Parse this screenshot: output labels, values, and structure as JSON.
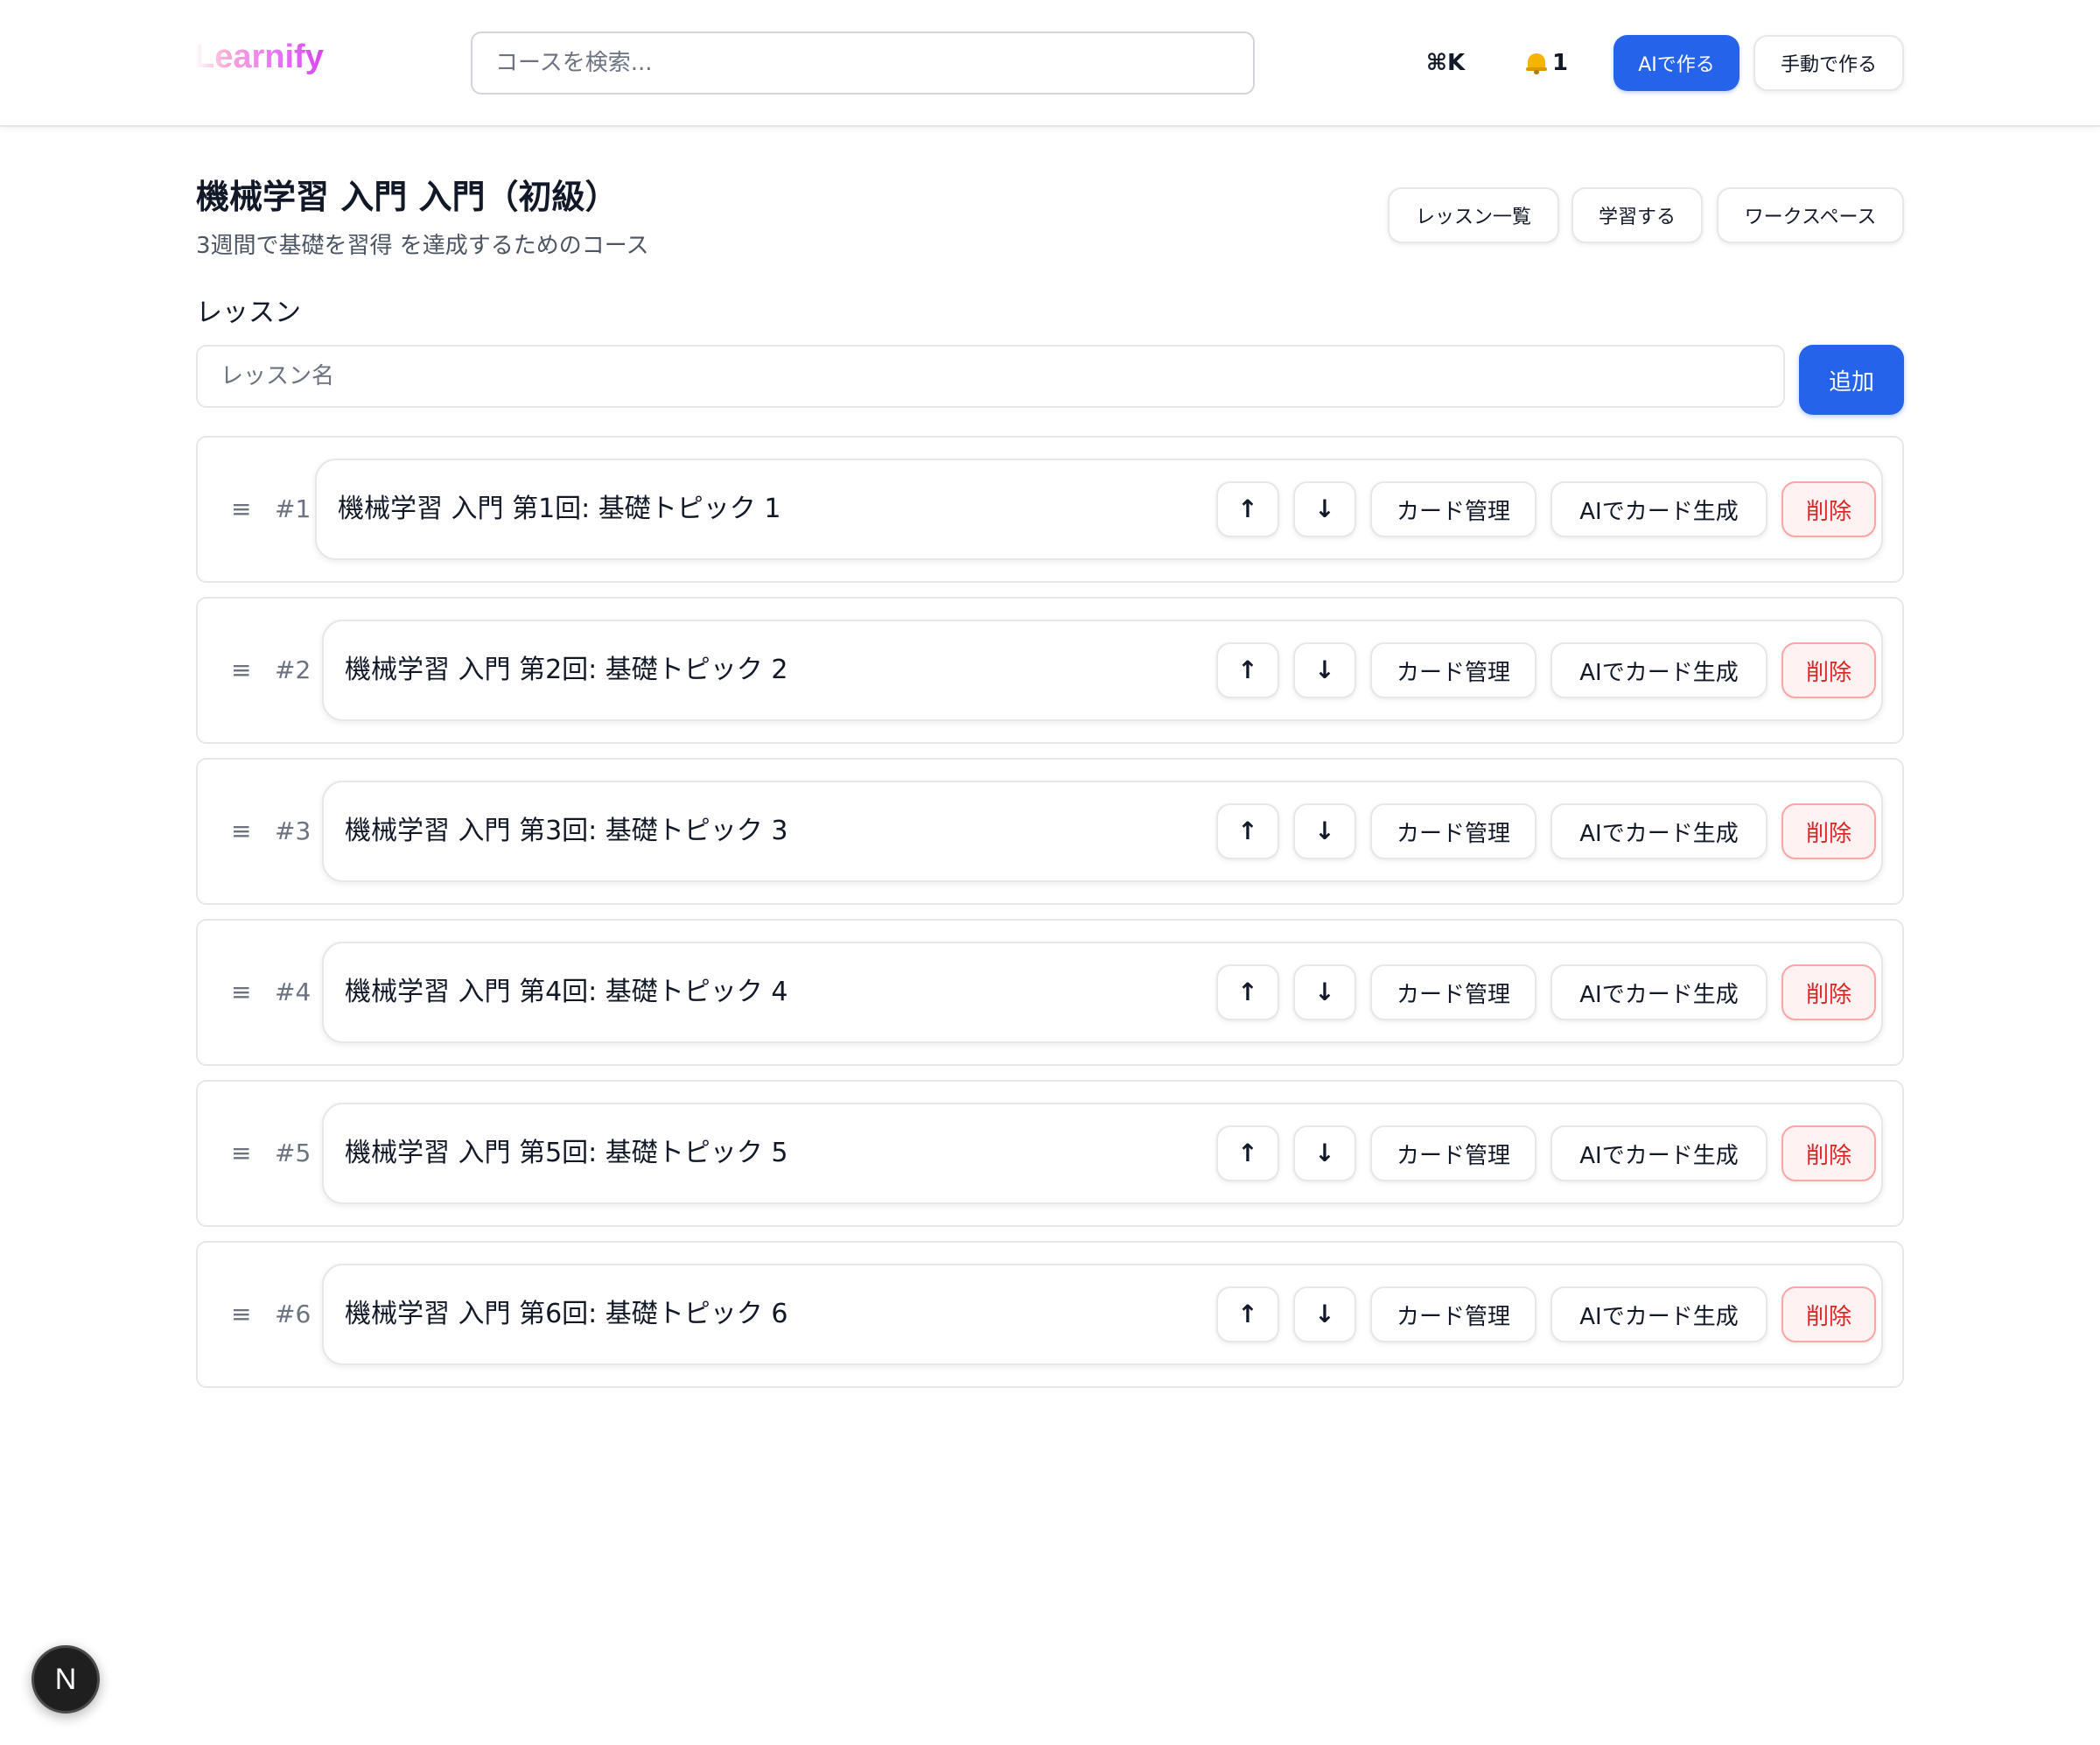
{
  "header": {
    "logo": "Learnify",
    "search_placeholder": "コースを検索...",
    "shortcut": "⌘K",
    "notification_count": "1",
    "ai_create_label": "AIで作る",
    "manual_create_label": "手動で作る"
  },
  "course": {
    "title": "機械学習 入門 入門（初級）",
    "subtitle": "3週間で基礎を習得 を達成するためのコース",
    "nav": {
      "lessons_label": "レッスン一覧",
      "study_label": "学習する",
      "workspace_label": "ワークスペース"
    }
  },
  "lessons_section": {
    "label": "レッスン",
    "input_placeholder": "レッスン名",
    "add_label": "追加"
  },
  "lesson_actions": {
    "up": "↑",
    "down": "↓",
    "cards": "カード管理",
    "ai_cards": "AIでカード生成",
    "delete": "削除"
  },
  "lessons": [
    {
      "num": "#1",
      "title": "機械学習 入門 第1回: 基礎トピック 1"
    },
    {
      "num": "#2",
      "title": "機械学習 入門 第2回: 基礎トピック 2"
    },
    {
      "num": "#3",
      "title": "機械学習 入門 第3回: 基礎トピック 3"
    },
    {
      "num": "#4",
      "title": "機械学習 入門 第4回: 基礎トピック 4"
    },
    {
      "num": "#5",
      "title": "機械学習 入門 第5回: 基礎トピック 5"
    },
    {
      "num": "#6",
      "title": "機械学習 入門 第6回: 基礎トピック 6"
    }
  ],
  "drag_icon": "≡",
  "dev_badge": "N",
  "colors": {
    "primary": "#2563eb",
    "danger": "#dc2626",
    "danger_bg": "#fef2f2",
    "logo_gradient_end": "#d946ef"
  }
}
